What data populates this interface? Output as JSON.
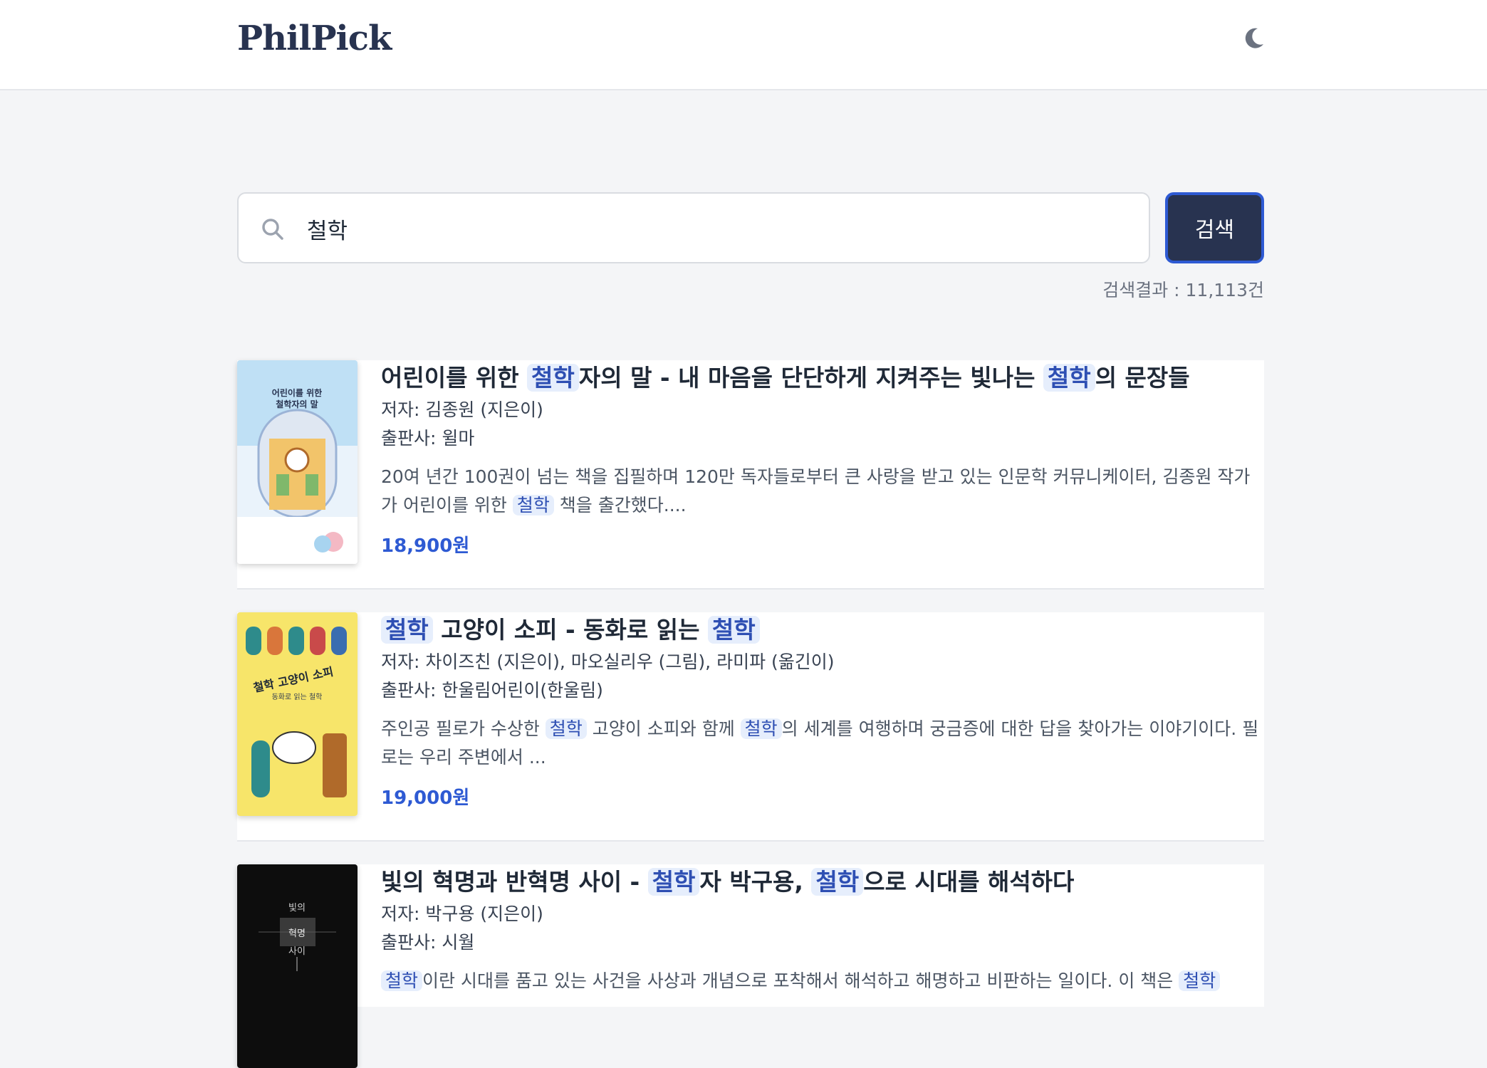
{
  "header": {
    "logo": "PhilPick",
    "theme_toggle_icon": "moon-icon"
  },
  "search": {
    "query": "철학",
    "button_label": "검색",
    "result_label": "검색결과 : ",
    "result_count": "11,113건"
  },
  "results": [
    {
      "title_parts": [
        "어린이를 위한 ",
        "철학",
        "자의 말 - 내 마음을 단단하게 지켜주는 빛나는 ",
        "철학",
        "의 문장들"
      ],
      "author": "저자: 김종원 (지은이)",
      "publisher": "출판사: 윌마",
      "desc_parts": [
        "20여 년간 100권이 넘는 책을 집필하며 120만 독자들로부터 큰 사랑을 받고 있는 인문학 커뮤니케이터, 김종원 작가가 어린이를 위한 ",
        "철학",
        " 책을 출간했다...."
      ],
      "price": "18,900원",
      "cover_text": [
        "어린이를 위한",
        "철학자의 말"
      ]
    },
    {
      "title_parts": [
        "철학",
        " 고양이 소피 - 동화로 읽는 ",
        "철학",
        ""
      ],
      "author": "저자: 차이즈친 (지은이), 마오실리우 (그림), 라미파 (옮긴이)",
      "publisher": "출판사: 한울림어린이(한울림)",
      "desc_parts": [
        "주인공 필로가 수상한 ",
        "철학",
        " 고양이 소피와 함께 ",
        "철학",
        "의 세계를 여행하며 궁금증에 대한 답을 찾아가는 이야기이다. 필로는 우리 주변에서 ..."
      ],
      "price": "19,000원",
      "cover_text": [
        "철학 고양이 소피",
        "동화로 읽는 철학"
      ]
    },
    {
      "title_parts": [
        "빛의 혁명과 반혁명 사이 - ",
        "철학",
        "자 박구용, ",
        "철학",
        "으로 시대를 해석하다"
      ],
      "author": "저자: 박구용 (지은이)",
      "publisher": "출판사: 시월",
      "desc_parts": [
        "철학",
        "이란 시대를 품고 있는 사건을 사상과 개념으로 포착해서 해석하고 해명하고 비판하는 일이다. 이 책은 ",
        "철학",
        ""
      ],
      "cover_text": [
        "빛의",
        "혁명",
        "사이"
      ]
    }
  ],
  "colors": {
    "primary": "#283350",
    "accent": "#2e5ad3",
    "highlight_bg": "#e6eefc"
  }
}
